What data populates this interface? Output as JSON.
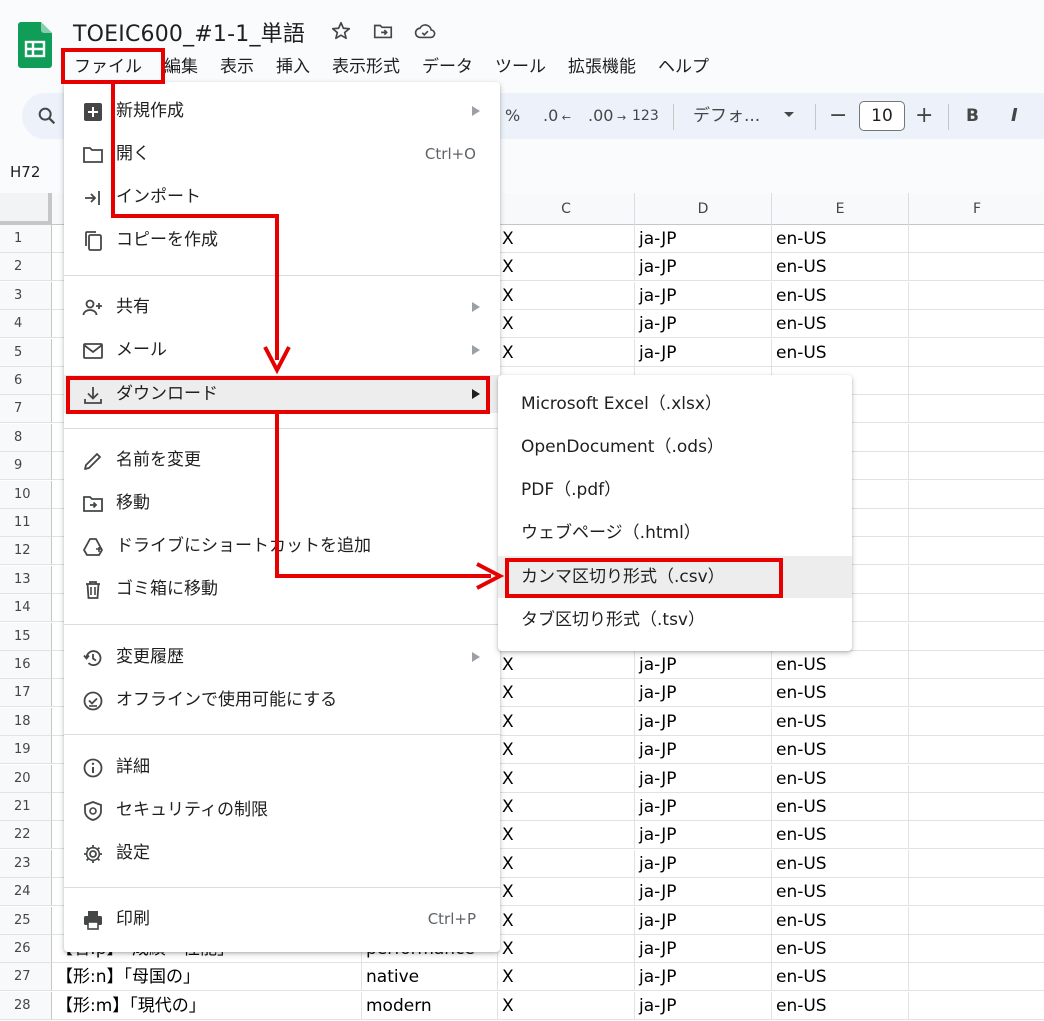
{
  "app": {
    "title": "TOEIC600_#1-1_単語",
    "accent_color": "#e60000",
    "logo_color": "#0f9d58"
  },
  "menubar": {
    "items": [
      "ファイル",
      "編集",
      "表示",
      "挿入",
      "表示形式",
      "データ",
      "ツール",
      "拡張機能",
      "ヘルプ"
    ]
  },
  "toolbar": {
    "percent": "%",
    "decrease_decimal": ".0",
    "increase_decimal": ".00",
    "number_format": "123",
    "font_name": "デフォ...",
    "font_size": "10",
    "minus": "−",
    "plus": "+",
    "bold": "B",
    "italic": "I"
  },
  "name_box": "H72",
  "columns": [
    "C",
    "D",
    "E",
    "F"
  ],
  "rows": [
    {
      "n": "1",
      "c": "X",
      "d": "ja-JP",
      "e": "en-US"
    },
    {
      "n": "2",
      "c": "X",
      "d": "ja-JP",
      "e": "en-US"
    },
    {
      "n": "3",
      "c": "X",
      "d": "ja-JP",
      "e": "en-US"
    },
    {
      "n": "4",
      "c": "X",
      "d": "ja-JP",
      "e": "en-US"
    },
    {
      "n": "5",
      "c": "X",
      "d": "ja-JP",
      "e": "en-US"
    },
    {
      "n": "6"
    },
    {
      "n": "7"
    },
    {
      "n": "8"
    },
    {
      "n": "9"
    },
    {
      "n": "10"
    },
    {
      "n": "11"
    },
    {
      "n": "12"
    },
    {
      "n": "13"
    },
    {
      "n": "14"
    },
    {
      "n": "15"
    },
    {
      "n": "16",
      "c": "X",
      "d": "ja-JP",
      "e": "en-US"
    },
    {
      "n": "17",
      "c": "X",
      "d": "ja-JP",
      "e": "en-US"
    },
    {
      "n": "18",
      "c": "X",
      "d": "ja-JP",
      "e": "en-US"
    },
    {
      "n": "19",
      "c": "X",
      "d": "ja-JP",
      "e": "en-US"
    },
    {
      "n": "20",
      "c": "X",
      "d": "ja-JP",
      "e": "en-US"
    },
    {
      "n": "21",
      "c": "X",
      "d": "ja-JP",
      "e": "en-US"
    },
    {
      "n": "22",
      "c": "X",
      "d": "ja-JP",
      "e": "en-US"
    },
    {
      "n": "23",
      "c": "X",
      "d": "ja-JP",
      "e": "en-US"
    },
    {
      "n": "24",
      "c": "X",
      "d": "ja-JP",
      "e": "en-US"
    },
    {
      "n": "25",
      "c": "X",
      "d": "ja-JP",
      "e": "en-US"
    },
    {
      "n": "26",
      "a": "【名:p】「成績・性能」",
      "b": "performance",
      "c": "X",
      "d": "ja-JP",
      "e": "en-US"
    },
    {
      "n": "27",
      "a": "【形:n】「母国の」",
      "b": "native",
      "c": "X",
      "d": "ja-JP",
      "e": "en-US"
    },
    {
      "n": "28",
      "a": "【形:m】「現代の」",
      "b": "modern",
      "c": "X",
      "d": "ja-JP",
      "e": "en-US"
    }
  ],
  "file_menu": {
    "new": "新規作成",
    "open": "開く",
    "open_shortcut": "Ctrl+O",
    "import": "インポート",
    "copy": "コピーを作成",
    "share": "共有",
    "email": "メール",
    "download": "ダウンロード",
    "rename": "名前を変更",
    "move": "移動",
    "shortcut": "ドライブにショートカットを追加",
    "trash": "ゴミ箱に移動",
    "history": "変更履歴",
    "offline": "オフラインで使用可能にする",
    "details": "詳細",
    "security": "セキュリティの制限",
    "settings": "設定",
    "print": "印刷",
    "print_shortcut": "Ctrl+P"
  },
  "download_menu": {
    "xlsx": "Microsoft Excel（.xlsx）",
    "ods": "OpenDocument（.ods）",
    "pdf": "PDF（.pdf）",
    "html": "ウェブページ（.html）",
    "csv": "カンマ区切り形式（.csv）",
    "tsv": "タブ区切り形式（.tsv）"
  }
}
